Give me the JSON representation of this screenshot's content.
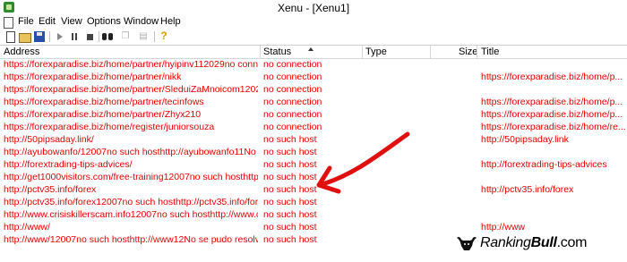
{
  "window": {
    "title": "Xenu - [Xenu1]"
  },
  "menu": [
    "File",
    "Edit",
    "View",
    "Options",
    "Window",
    "Help"
  ],
  "toolbar": [
    {
      "name": "new-document-icon"
    },
    {
      "name": "open-folder-icon"
    },
    {
      "name": "save-disk-icon"
    },
    {
      "name": "play-icon"
    },
    {
      "name": "pause-icon"
    },
    {
      "name": "stop-icon"
    },
    {
      "name": "binoculars-icon"
    },
    {
      "name": "copy-icon"
    },
    {
      "name": "properties-icon"
    },
    {
      "name": "help-icon"
    }
  ],
  "columns": {
    "address": "Address",
    "status": "Status",
    "type": "Type",
    "size": "Size",
    "title": "Title"
  },
  "sort": {
    "column": "status",
    "direction": "ascending"
  },
  "rows": [
    {
      "address": "https://forexparadise.biz/home/partner/hyipinv112029no connectionh...",
      "status": "no connection",
      "title": ""
    },
    {
      "address": "https://forexparadise.biz/home/partner/nikk",
      "status": "no connection",
      "title": "https://forexparadise.biz/home/p..."
    },
    {
      "address": "https://forexparadise.biz/home/partner/SleduiZaMnoicom12029no con...",
      "status": "no connection",
      "title": ""
    },
    {
      "address": "https://forexparadise.biz/home/partner/tecinfows",
      "status": "no connection",
      "title": "https://forexparadise.biz/home/p..."
    },
    {
      "address": "https://forexparadise.biz/home/partner/Zhyx210",
      "status": "no connection",
      "title": "https://forexparadise.biz/home/p..."
    },
    {
      "address": "https://forexparadise.biz/home/register/juniorsouza",
      "status": "no connection",
      "title": "https://forexparadise.biz/home/re..."
    },
    {
      "address": "http://50pipsaday.link/",
      "status": "no such host",
      "title": "http://50pipsaday.link"
    },
    {
      "address": "http://ayubowanfo/12007no such hosthttp://ayubowanfo11No se pud...",
      "status": "no such host",
      "title": ""
    },
    {
      "address": "http://forextrading-tips-advices/",
      "status": "no such host",
      "title": "http://forextrading-tips-advices"
    },
    {
      "address": "http://get1000visitors.com/free-training12007no such hosthttp://get1...",
      "status": "no such host",
      "title": ""
    },
    {
      "address": "http://pctv35.info/forex",
      "status": "no such host",
      "title": "http://pctv35.info/forex"
    },
    {
      "address": "http://pctv35.info/forex12007no such hosthttp://pctv35.info/forex11N...",
      "status": "no such host",
      "title": ""
    },
    {
      "address": "http://www.crisiskillerscam.info12007no such hosthttp://www.crisiski...",
      "status": "no such host",
      "title": ""
    },
    {
      "address": "http://www/",
      "status": "no such host",
      "title": "http://www"
    },
    {
      "address": "http://www/12007no such hosthttp://www12No se pudo resolver el n...",
      "status": "no such host",
      "title": ""
    }
  ],
  "colors": {
    "link_error": "#e60000",
    "annotation_arrow": "#e01010",
    "brand_text": "#000000"
  },
  "brand": {
    "part1": "Ranking",
    "part2": "Bull",
    "part3": ".com"
  }
}
